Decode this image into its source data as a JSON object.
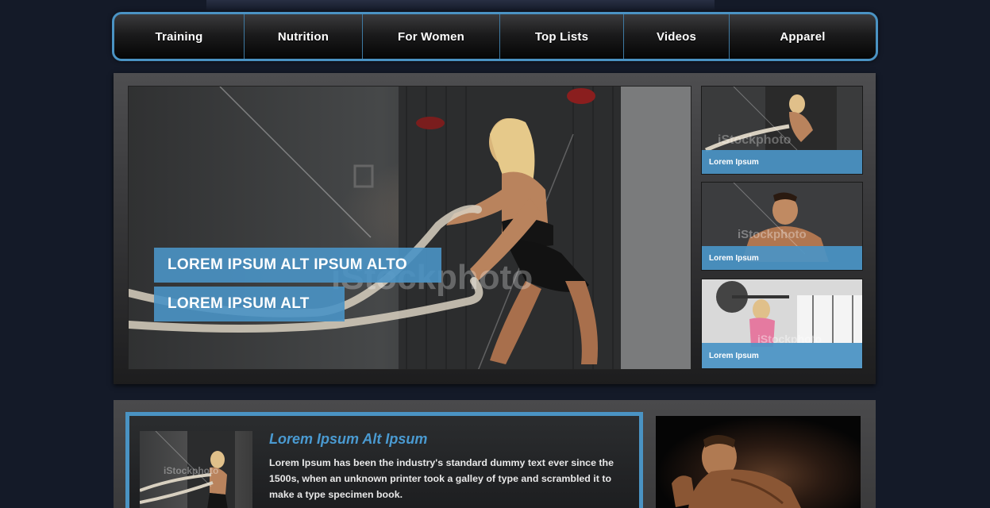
{
  "nav": {
    "items": [
      {
        "label": "Training",
        "width": 164
      },
      {
        "label": "Nutrition",
        "width": 149
      },
      {
        "label": "For Women",
        "width": 173
      },
      {
        "label": "Top Lists",
        "width": 156
      },
      {
        "label": "Videos",
        "width": 133
      },
      {
        "label": "Apparel",
        "width": 184
      }
    ]
  },
  "hero": {
    "banner_primary": "LOREM IPSUM ALT IPSUM ALTO",
    "banner_secondary": "LOREM IPSUM ALT",
    "watermark": "iStockphoto"
  },
  "thumbnails": [
    {
      "label": "Lorem Ipsum",
      "watermark": "iStockphoto"
    },
    {
      "label": "Lorem Ipsum",
      "watermark": "iStockphoto"
    },
    {
      "label": "Lorem Ipsum",
      "watermark": "iStockphoto"
    }
  ],
  "feature": {
    "title": "Lorem Ipsum Alt Ipsum",
    "body": "Lorem Ipsum has been the industry's standard dummy text ever since the 1500s, when an unknown printer took a galley of type and scrambled it to make a type specimen book.",
    "thumb_watermark": "iStockphoto"
  },
  "colors": {
    "accent": "#4a93c3",
    "page_bg": "#141a28",
    "title_blue": "#4a9ad1"
  }
}
